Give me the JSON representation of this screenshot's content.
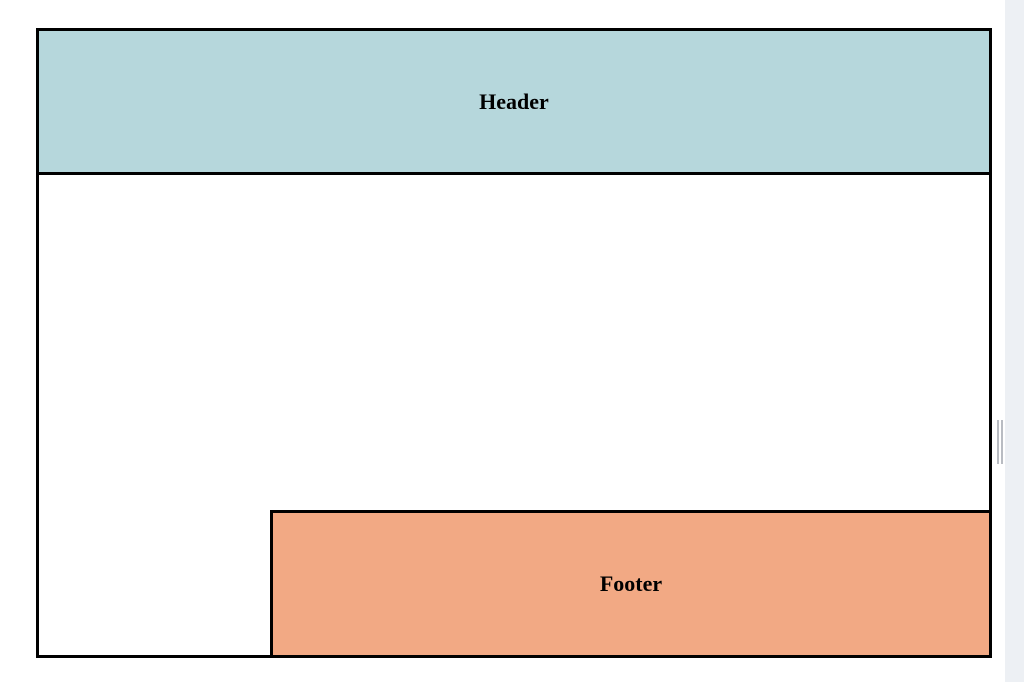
{
  "layout": {
    "header_label": "Header",
    "footer_label": "Footer"
  },
  "colors": {
    "page_bg": "#edf0f4",
    "canvas_bg": "#ffffff",
    "header_bg": "#b6d7dc",
    "footer_bg": "#f2a984",
    "border": "#000000"
  }
}
